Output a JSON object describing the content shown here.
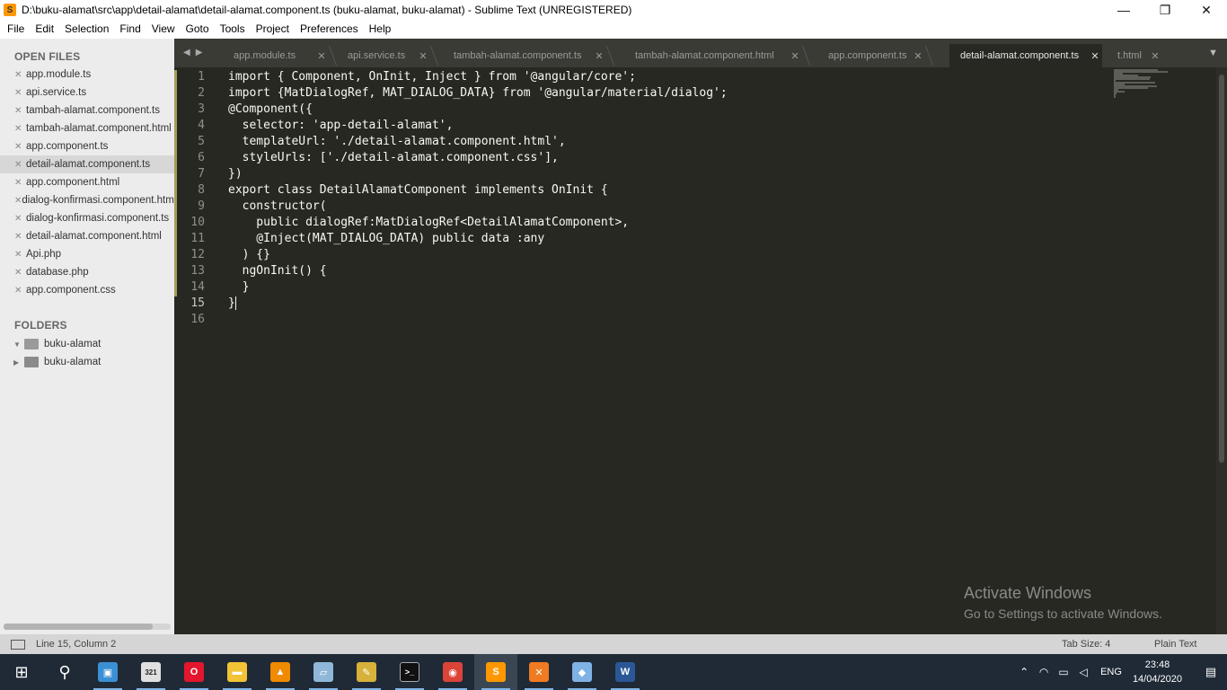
{
  "window": {
    "title": "D:\\buku-alamat\\src\\app\\detail-alamat\\detail-alamat.component.ts (buku-alamat, buku-alamat) - Sublime Text (UNREGISTERED)",
    "minimize": "—",
    "maximize": "❐",
    "close": "✕"
  },
  "menu": [
    "File",
    "Edit",
    "Selection",
    "Find",
    "View",
    "Goto",
    "Tools",
    "Project",
    "Preferences",
    "Help"
  ],
  "sidebar": {
    "open_files_label": "OPEN FILES",
    "folders_label": "FOLDERS",
    "files": [
      {
        "name": "app.module.ts"
      },
      {
        "name": "api.service.ts"
      },
      {
        "name": "tambah-alamat.component.ts"
      },
      {
        "name": "tambah-alamat.component.html"
      },
      {
        "name": "app.component.ts"
      },
      {
        "name": "detail-alamat.component.ts",
        "selected": true
      },
      {
        "name": "app.component.html"
      },
      {
        "name": "dialog-konfirmasi.component.html"
      },
      {
        "name": "dialog-konfirmasi.component.ts"
      },
      {
        "name": "detail-alamat.component.html"
      },
      {
        "name": "Api.php"
      },
      {
        "name": "database.php"
      },
      {
        "name": "app.component.css"
      }
    ],
    "folders": [
      {
        "name": "buku-alamat",
        "expanded": true
      },
      {
        "name": "buku-alamat",
        "expanded": false
      }
    ]
  },
  "tabs": [
    {
      "label": "app.module.ts"
    },
    {
      "label": "api.service.ts"
    },
    {
      "label": "tambah-alamat.component.ts"
    },
    {
      "label": "tambah-alamat.component.html"
    },
    {
      "label": "app.component.ts"
    },
    {
      "label": "detail-alamat.component.ts",
      "active": true
    },
    {
      "label": "t.html"
    }
  ],
  "editor": {
    "current_line": 15,
    "lines": [
      "import { Component, OnInit, Inject } from '@angular/core';",
      "import {MatDialogRef, MAT_DIALOG_DATA} from '@angular/material/dialog';",
      "@Component({",
      "  selector: 'app-detail-alamat',",
      "  templateUrl: './detail-alamat.component.html',",
      "  styleUrls: ['./detail-alamat.component.css'],",
      "})",
      "export class DetailAlamatComponent implements OnInit {",
      "  constructor(",
      "    public dialogRef:MatDialogRef<DetailAlamatComponent>,",
      "    @Inject(MAT_DIALOG_DATA) public data :any",
      "  ) {}",
      "  ngOnInit() {",
      "  }",
      "}",
      ""
    ]
  },
  "watermark": {
    "line1": "Activate Windows",
    "line2": "Go to Settings to activate Windows."
  },
  "status": {
    "position": "Line 15, Column 2",
    "tab_size": "Tab Size: 4",
    "syntax": "Plain Text"
  },
  "taskbar": {
    "apps": [
      {
        "icon": "windows-start-icon",
        "color": "#ffffff",
        "glyph": "⊞"
      },
      {
        "icon": "search-icon",
        "color": "#ffffff",
        "glyph": "⚲"
      },
      {
        "icon": "control-panel-icon",
        "color": "#3b8fd4",
        "glyph": "▣"
      },
      {
        "icon": "calendar-app-icon",
        "color": "#e0e0e0",
        "glyph": "321"
      },
      {
        "icon": "opera-icon",
        "color": "#e3162d",
        "glyph": "O"
      },
      {
        "icon": "file-explorer-icon",
        "color": "#f2c335",
        "glyph": "▬"
      },
      {
        "icon": "vlc-icon",
        "color": "#f08a00",
        "glyph": "▲"
      },
      {
        "icon": "notebook-app-icon",
        "color": "#8fb8d8",
        "glyph": "▱"
      },
      {
        "icon": "tools-app-icon",
        "color": "#d8b13a",
        "glyph": "✎"
      },
      {
        "icon": "terminal-icon",
        "color": "#111111",
        "glyph": ">_"
      },
      {
        "icon": "chrome-icon",
        "color": "#db4437",
        "glyph": "◉"
      },
      {
        "icon": "sublime-text-icon",
        "color": "#ff9800",
        "glyph": "S",
        "active": true
      },
      {
        "icon": "xampp-icon",
        "color": "#f07b22",
        "glyph": "✕"
      },
      {
        "icon": "virtualbox-icon",
        "color": "#7fb2e5",
        "glyph": "◆"
      },
      {
        "icon": "word-icon",
        "color": "#2b5797",
        "glyph": "W"
      }
    ],
    "language": "ENG",
    "time": "23:48",
    "date": "14/04/2020"
  }
}
